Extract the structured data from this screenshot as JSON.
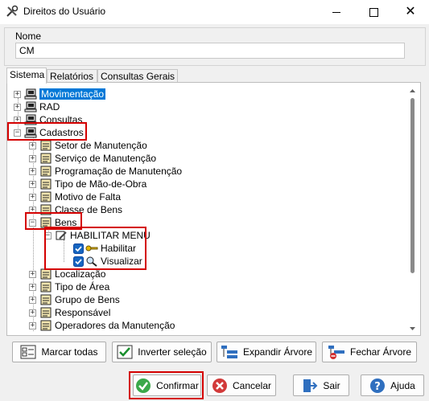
{
  "window": {
    "title": "Direitos do Usuário"
  },
  "form": {
    "nome_label": "Nome",
    "nome_value": "CM"
  },
  "tabs": [
    "Sistema",
    "Relatórios",
    "Consultas Gerais"
  ],
  "tree": {
    "roots": [
      "Movimentação",
      "RAD",
      "Consultas",
      "Cadastros"
    ],
    "cadastros_children": [
      "Setor de Manutenção",
      "Serviço de Manutenção",
      "Programação de Manutenção",
      "Tipo de Mão-de-Obra",
      "Motivo de Falta",
      "Classe de Bens",
      "Bens"
    ],
    "bens_menu": "HABILITAR MENU",
    "bens_options": [
      "Habilitar",
      "Visualizar"
    ],
    "after_bens": [
      "Localização",
      "Tipo de Área",
      "Grupo de Bens",
      "Responsável",
      "Operadores da Manutenção"
    ]
  },
  "tree_buttons": {
    "mark_all": "Marcar todas",
    "invert": "Inverter seleção",
    "expand": "Expandir Árvore",
    "collapse": "Fechar Árvore"
  },
  "footer_buttons": {
    "confirm": "Confirmar",
    "cancel": "Cancelar",
    "exit": "Sair",
    "help": "Ajuda"
  },
  "colors": {
    "selection": "#0078d7",
    "highlight": "#d40000",
    "check": "#1565c0"
  }
}
